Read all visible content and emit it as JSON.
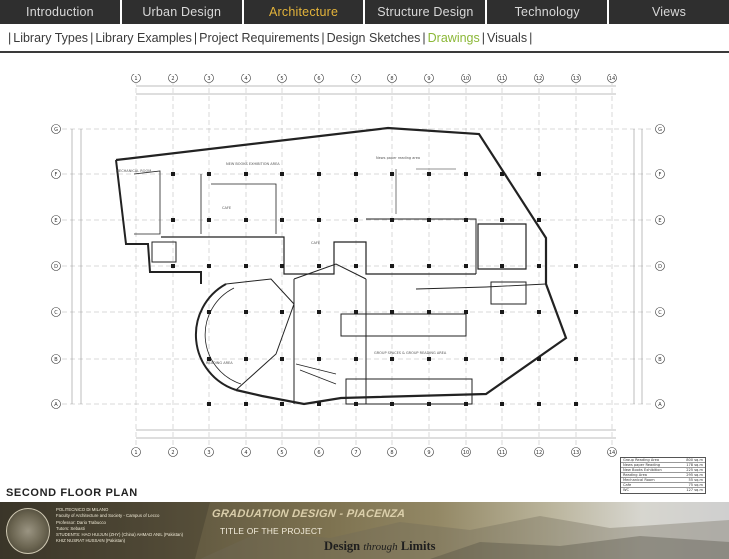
{
  "nav": {
    "tabs": [
      {
        "label": "Introduction",
        "active": false
      },
      {
        "label": "Urban Design",
        "active": false
      },
      {
        "label": "Architecture",
        "active": true
      },
      {
        "label": "Structure Design",
        "active": false
      },
      {
        "label": "Technology",
        "active": false
      },
      {
        "label": "Views",
        "active": false
      }
    ]
  },
  "subnav": {
    "items": [
      {
        "label": "Library Types",
        "active": false
      },
      {
        "label": "Library Examples",
        "active": false
      },
      {
        "label": "Project Requirements",
        "active": false
      },
      {
        "label": "Design Sketches",
        "active": false
      },
      {
        "label": "Drawings",
        "active": true
      },
      {
        "label": "Visuals",
        "active": false
      }
    ]
  },
  "drawing": {
    "grid_letters": [
      "G",
      "F",
      "E",
      "D",
      "C",
      "B",
      "A"
    ],
    "grid_numbers": [
      "1",
      "2",
      "3",
      "4",
      "5",
      "6",
      "7",
      "8",
      "9",
      "10",
      "11",
      "12",
      "13",
      "14"
    ]
  },
  "plan_title": "SECOND FLOOR PLAN",
  "area_table": {
    "rows": [
      {
        "name": "Group Reading Area",
        "value": "800 sq.m"
      },
      {
        "name": "News paper Reading",
        "value": "178 sq.m"
      },
      {
        "name": "New Books Exhibition",
        "value": "225 sq.m"
      },
      {
        "name": "Reading Area",
        "value": "295 sq.m"
      },
      {
        "name": "Mechanical Room",
        "value": "55 sq.m"
      },
      {
        "name": "Cafe",
        "value": "75 sq.m"
      },
      {
        "name": "WC",
        "value": "127 sq.m"
      }
    ]
  },
  "banner": {
    "credits": [
      "POLITECNICO DI MILANO",
      "Faculty of Architecture and Society - Campus of Lecco",
      "Professor: Dario Trabucco",
      "Tutors: Sebasti",
      "STUDENTS: HAO HUIJUN  (ZHY)  (China)   AHMAD  ANIL  (Pakistan)",
      "KHIZ NUSRAT HUSSAIN  (Pakistan)"
    ],
    "graduation_title": "GRADUATION DESIGN - PIACENZA",
    "project_title": "TITLE OF THE PROJECT",
    "tagline_start": "Design",
    "tagline_mid": "through",
    "tagline_end": "Limits"
  }
}
